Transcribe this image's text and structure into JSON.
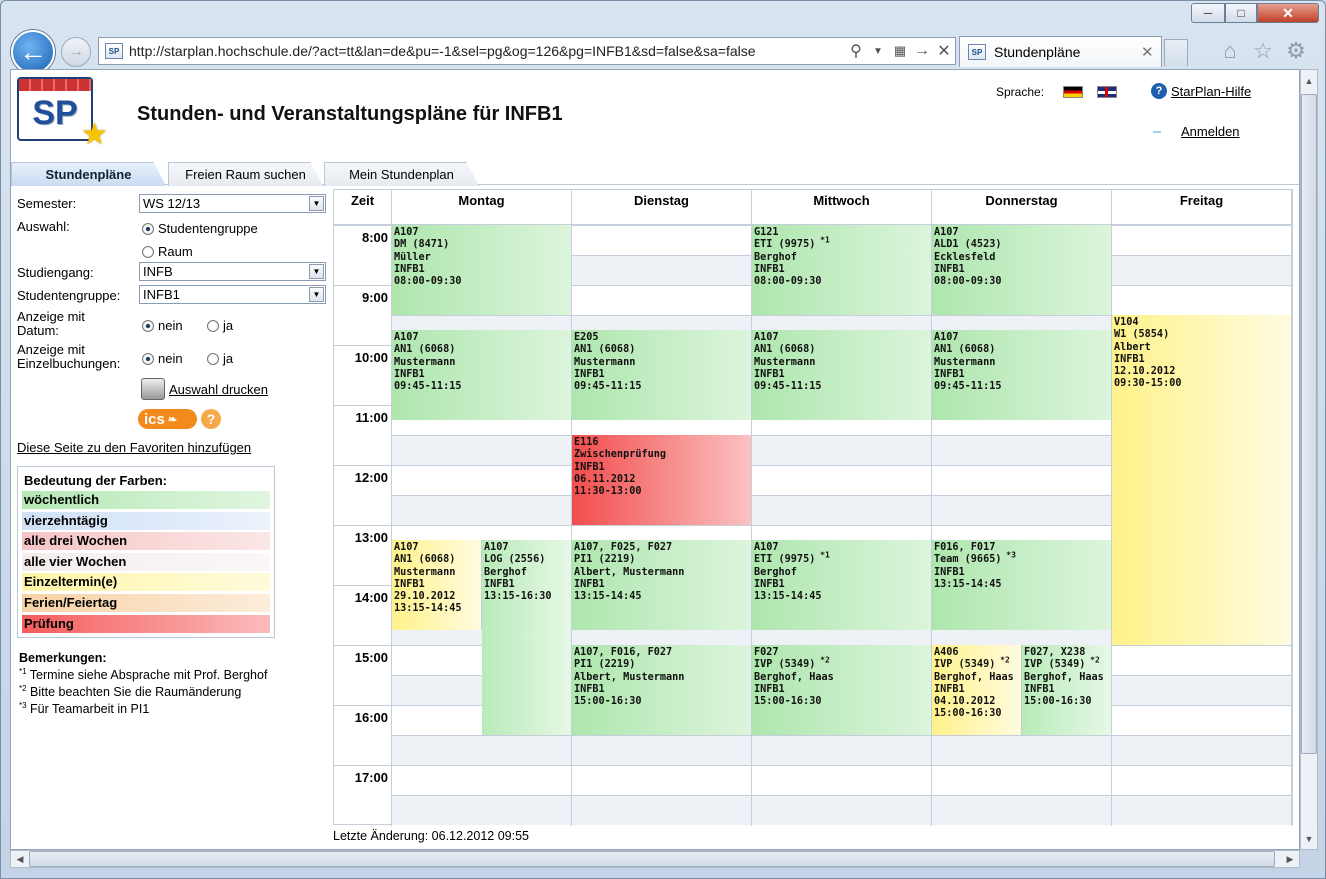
{
  "browser": {
    "url": "http://starplan.hochschule.de/?act=tt&lan=de&pu=-1&sel=pg&og=126&pg=INFB1&sd=false&sa=false",
    "tab_title": "Stundenpläne",
    "favicon_text": "SP",
    "icons": [
      "back-icon",
      "forward-icon",
      "search-icon",
      "dropdown-icon",
      "compat-icon",
      "go-icon",
      "stop-icon",
      "home-icon",
      "star-icon",
      "gear-icon"
    ]
  },
  "header": {
    "logo_text": "SP",
    "title": "Stunden- und Veranstaltungspläne für INFB1",
    "language_label": "Sprache:",
    "help_label": "StarPlan-Hilfe",
    "login_label": "Anmelden"
  },
  "tabs": [
    "Stundenpläne",
    "Freien Raum suchen",
    "Mein Stundenplan"
  ],
  "form": {
    "semester_label": "Semester:",
    "semester_value": "WS 12/13",
    "selection_label": "Auswahl:",
    "opt_group": "Studentengruppe",
    "opt_room": "Raum",
    "program_label": "Studiengang:",
    "program_value": "INFB",
    "group_label": "Studentengruppe:",
    "group_value": "INFB1",
    "date_label_1": "Anzeige mit",
    "date_label_2": "Datum:",
    "single_label_1": "Anzeige mit",
    "single_label_2": "Einzelbuchungen:",
    "no": "nein",
    "yes": "ja",
    "print_label": "Auswahl drucken",
    "ics_label": "ics",
    "ics_help": "?",
    "favorites_label": "Diese Seite zu den Favoriten hinzufügen"
  },
  "legend": {
    "title": "Bedeutung der Farben:",
    "items": [
      {
        "label": "wöchentlich",
        "color": "#b4e8b4"
      },
      {
        "label": "vierzehntägig",
        "color": "#cfe0f7"
      },
      {
        "label": "alle drei Wochen",
        "color": "#f6c4c4"
      },
      {
        "label": "alle vier Wochen",
        "color": "#f5ecec"
      },
      {
        "label": "Einzeltermin(e)",
        "color": "#fff6a8"
      },
      {
        "label": "Ferien/Feiertag",
        "color": "#f8d2a6"
      },
      {
        "label": "Prüfung",
        "color": "#f55c5c"
      }
    ]
  },
  "remarks": {
    "title": "Bemerkungen:",
    "items": [
      {
        "mark": "*1",
        "text": "Termine siehe Absprache mit Prof. Berghof"
      },
      {
        "mark": "*2",
        "text": "Bitte beachten Sie die Raumänderung"
      },
      {
        "mark": "*3",
        "text": "Für Teamarbeit in PI1"
      }
    ]
  },
  "timetable": {
    "time_header": "Zeit",
    "days": [
      "Montag",
      "Dienstag",
      "Mittwoch",
      "Donnerstag",
      "Freitag"
    ],
    "hours": [
      "8:00",
      "9:00",
      "10:00",
      "11:00",
      "12:00",
      "13:00",
      "14:00",
      "15:00",
      "16:00",
      "17:00"
    ],
    "events": [
      {
        "room": "A107",
        "course": "DM (8471)",
        "person": "Müller",
        "group": "INFB1",
        "date": "",
        "time": "08:00-09:30",
        "mark": ""
      },
      {
        "room": "G121",
        "course": "ETI (9975)",
        "person": "Berghof",
        "group": "INFB1",
        "date": "",
        "time": "08:00-09:30",
        "mark": "*1"
      },
      {
        "room": "A107",
        "course": "ALD1 (4523)",
        "person": "Ecklesfeld",
        "group": "INFB1",
        "date": "",
        "time": "08:00-09:30",
        "mark": ""
      },
      {
        "room": "A107",
        "course": "AN1 (6068)",
        "person": "Mustermann",
        "group": "INFB1",
        "date": "",
        "time": "09:45-11:15",
        "mark": ""
      },
      {
        "room": "E205",
        "course": "AN1 (6068)",
        "person": "Mustermann",
        "group": "INFB1",
        "date": "",
        "time": "09:45-11:15",
        "mark": ""
      },
      {
        "room": "A107",
        "course": "AN1 (6068)",
        "person": "Mustermann",
        "group": "INFB1",
        "date": "",
        "time": "09:45-11:15",
        "mark": ""
      },
      {
        "room": "A107",
        "course": "AN1 (6068)",
        "person": "Mustermann",
        "group": "INFB1",
        "date": "",
        "time": "09:45-11:15",
        "mark": ""
      },
      {
        "room": "V104",
        "course": "W1 (5854)",
        "person": "Albert",
        "group": "INFB1",
        "date": "12.10.2012",
        "time": "09:30-15:00",
        "mark": ""
      },
      {
        "room": "E116",
        "course": "Zwischenprüfung",
        "person": "",
        "group": "INFB1",
        "date": "06.11.2012",
        "time": "11:30-13:00",
        "mark": ""
      },
      {
        "room": "A107",
        "course": "AN1 (6068)",
        "person": "Mustermann",
        "group": "INFB1",
        "date": "29.10.2012",
        "time": "13:15-14:45",
        "mark": ""
      },
      {
        "room": "A107",
        "course": "LOG (2556)",
        "person": "Berghof",
        "group": "INFB1",
        "date": "",
        "time": "13:15-16:30",
        "mark": ""
      },
      {
        "room": "A107, F025, F027",
        "course": "PI1 (2219)",
        "person": "Albert, Mustermann",
        "group": "INFB1",
        "date": "",
        "time": "13:15-14:45",
        "mark": ""
      },
      {
        "room": "A107",
        "course": "ETI (9975)",
        "person": "Berghof",
        "group": "INFB1",
        "date": "",
        "time": "13:15-14:45",
        "mark": "*1"
      },
      {
        "room": "F016, F017",
        "course": "Team (9665)",
        "person": "",
        "group": "INFB1",
        "date": "",
        "time": "13:15-14:45",
        "mark": "*3"
      },
      {
        "room": "A107, F016, F027",
        "course": "PI1 (2219)",
        "person": "Albert, Mustermann",
        "group": "INFB1",
        "date": "",
        "time": "15:00-16:30",
        "mark": ""
      },
      {
        "room": "F027",
        "course": "IVP (5349)",
        "person": "Berghof, Haas",
        "group": "INFB1",
        "date": "",
        "time": "15:00-16:30",
        "mark": "*2"
      },
      {
        "room": "A406",
        "course": "IVP (5349)",
        "person": "Berghof, Haas",
        "group": "INFB1",
        "date": "04.10.2012",
        "time": "15:00-16:30",
        "mark": "*2"
      },
      {
        "room": "F027, X238",
        "course": "IVP (5349)",
        "person": "Berghof, Haas",
        "group": "INFB1",
        "date": "",
        "time": "15:00-16:30",
        "mark": "*2"
      }
    ]
  },
  "last_change": "Letzte Änderung: 06.12.2012 09:55"
}
